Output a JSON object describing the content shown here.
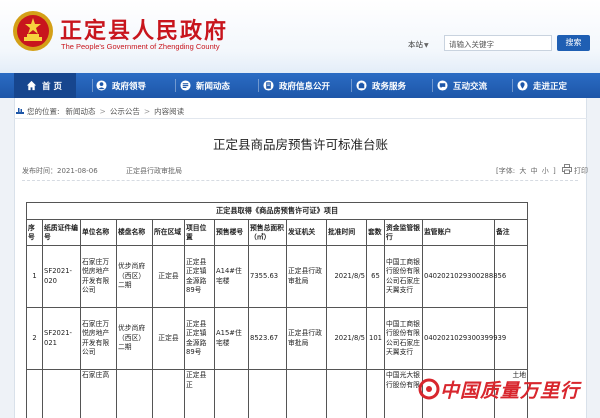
{
  "header": {
    "site_title": "正定县人民政府",
    "site_subtitle": "The People's Government of Zhengding County",
    "search_scope": "本站",
    "search_placeholder": "请输入关键字",
    "search_button": "搜索"
  },
  "nav": {
    "items": [
      {
        "label": "首 页",
        "icon": "home-icon",
        "active": true
      },
      {
        "label": "政府领导",
        "icon": "user-icon"
      },
      {
        "label": "新闻动态",
        "icon": "news-icon"
      },
      {
        "label": "政府信息公开",
        "icon": "document-icon"
      },
      {
        "label": "政务服务",
        "icon": "service-icon"
      },
      {
        "label": "互动交流",
        "icon": "chat-icon"
      },
      {
        "label": "走进正定",
        "icon": "location-icon"
      }
    ]
  },
  "breadcrumb": {
    "prefix": "您的位置:",
    "items": [
      "新闻动态",
      "公示公告",
      "内容阅读"
    ],
    "separator": ">"
  },
  "article": {
    "title": "正定县商品房预售许可标准台账",
    "publish_time": "发布时间：2021-08-06",
    "source": "正定县行政审批局",
    "font_size_label": "[字体:",
    "font_large": "大",
    "font_medium": "中",
    "font_small": "小",
    "font_close": "]",
    "print_label": "打印"
  },
  "table": {
    "caption": "正定县取得《商品房预售许可证》项目",
    "headers": [
      "序号",
      "纸质证件编号",
      "单位名称",
      "楼盘名称",
      "所在区域",
      "项目位置",
      "预售楼号",
      "预售总面积（㎡）",
      "发证机关",
      "批准时间",
      "套数",
      "资金监管银行",
      "监管账户",
      "备注"
    ],
    "rows": [
      [
        "1",
        "SF2021-020",
        "石家庄万悦房地产开发有限公司",
        "优步尚府（西区）二期",
        "正定县",
        "正定县正定镇金源路89号",
        "A14#住宅楼",
        "7355.63",
        "正定县行政审批局",
        "2021/8/5",
        "65",
        "中国工商银行股份有限公司石家庄天翼支行",
        "0402021029300288856",
        ""
      ],
      [
        "2",
        "SF2021-021",
        "石家庄万悦房地产开发有限公司",
        "优步尚府（西区）二期",
        "正定县",
        "正定县正定镇金源路89号",
        "A15#住宅楼",
        "8523.67",
        "正定县行政审批局",
        "2021/8/5",
        "101",
        "中国工商银行股份有限公司石家庄天翼支行",
        "0402021029300399939",
        ""
      ],
      [
        "",
        "",
        "石家庄高",
        "",
        "",
        "正定县正",
        "",
        "",
        "",
        "",
        "",
        "中国光大银行股份有限",
        "",
        "土地"
      ]
    ]
  },
  "watermark": {
    "text": "中国质量万里行"
  },
  "colors": {
    "brand_red": "#c8151d",
    "nav_blue": "#1d56a8",
    "search_blue": "#1f5fb3"
  }
}
